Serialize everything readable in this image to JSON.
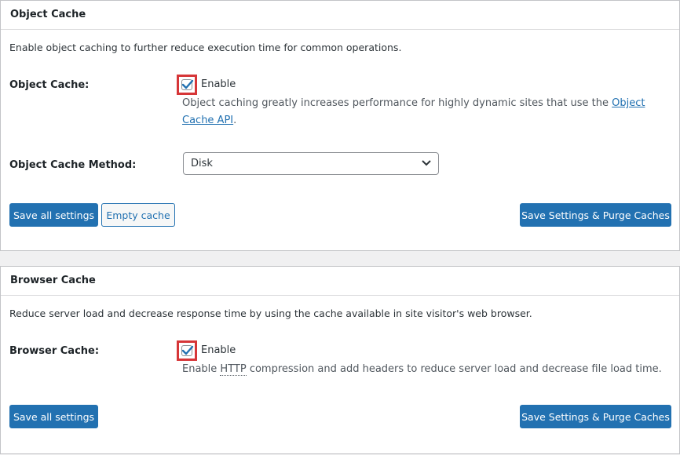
{
  "object_cache": {
    "title": "Object Cache",
    "description": "Enable object caching to further reduce execution time for common operations.",
    "field_label": "Object Cache:",
    "checkbox_label": "Enable",
    "help_text_before_link": "Object caching greatly increases performance for highly dynamic sites that use the ",
    "help_link_text": "Object Cache API",
    "help_text_after_link": ".",
    "method_label": "Object Cache Method:",
    "method_value": "Disk",
    "save_all_label": "Save all settings",
    "empty_cache_label": "Empty cache",
    "save_purge_label": "Save Settings & Purge Caches"
  },
  "browser_cache": {
    "title": "Browser Cache",
    "description": "Reduce server load and decrease response time by using the cache available in site visitor's web browser.",
    "field_label": "Browser Cache:",
    "checkbox_label": "Enable",
    "help_text_before_abbr": "Enable ",
    "help_abbr": "HTTP",
    "help_text_after_abbr": " compression and add headers to reduce server load and decrease file load time.",
    "save_all_label": "Save all settings",
    "save_purge_label": "Save Settings & Purge Caches"
  },
  "colors": {
    "primary": "#2271b1",
    "highlight": "#d63638"
  },
  "icons": {
    "checkbox": "check-icon",
    "select": "chevron-down-icon"
  }
}
